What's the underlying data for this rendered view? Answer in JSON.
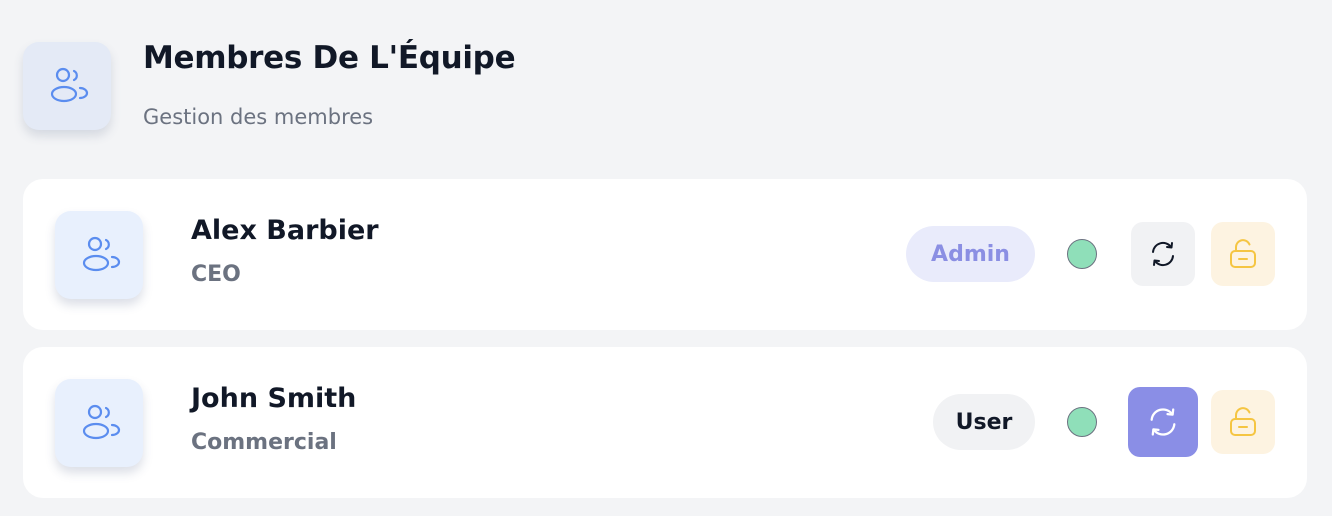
{
  "header": {
    "title": "Membres De L'Équipe",
    "subtitle": "Gestion des membres",
    "icon": "users-icon"
  },
  "members": [
    {
      "name": "Alex Barbier",
      "role": "CEO",
      "badge": "Admin",
      "badge_color": "#8b8fe3",
      "status_color": "#8fdfb9",
      "reset_active": false,
      "icons": [
        "users-icon",
        "refresh-icon",
        "unlock-icon"
      ]
    },
    {
      "name": "John Smith",
      "role": "Commercial",
      "badge": "User",
      "badge_color": "#111827",
      "status_color": "#8fdfb9",
      "reset_active": true,
      "icons": [
        "users-icon",
        "refresh-icon",
        "unlock-icon"
      ]
    }
  ],
  "colors": {
    "accent": "#8a8ee6",
    "icon_blue": "#5b8def",
    "unlock_yellow": "#f5c542",
    "background": "#f3f4f6"
  }
}
